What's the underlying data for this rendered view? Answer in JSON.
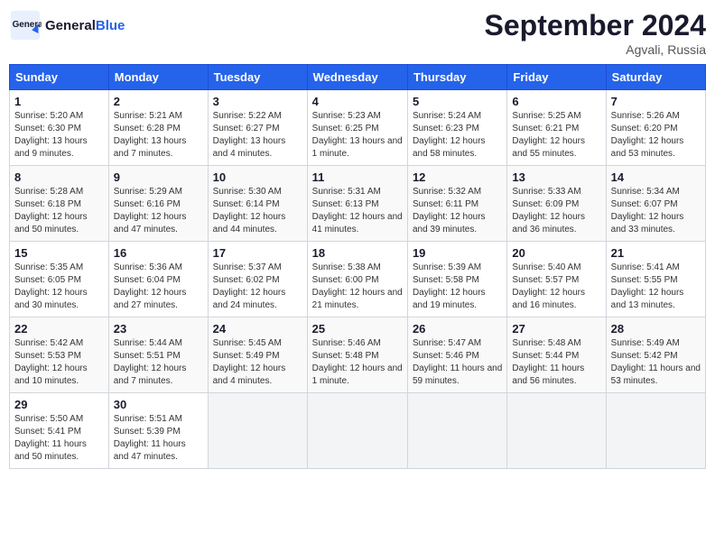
{
  "logo": {
    "text_general": "General",
    "text_blue": "Blue"
  },
  "title": "September 2024",
  "location": "Agvali, Russia",
  "weekdays": [
    "Sunday",
    "Monday",
    "Tuesday",
    "Wednesday",
    "Thursday",
    "Friday",
    "Saturday"
  ],
  "weeks": [
    [
      {
        "day": "1",
        "sunrise": "Sunrise: 5:20 AM",
        "sunset": "Sunset: 6:30 PM",
        "daylight": "Daylight: 13 hours and 9 minutes."
      },
      {
        "day": "2",
        "sunrise": "Sunrise: 5:21 AM",
        "sunset": "Sunset: 6:28 PM",
        "daylight": "Daylight: 13 hours and 7 minutes."
      },
      {
        "day": "3",
        "sunrise": "Sunrise: 5:22 AM",
        "sunset": "Sunset: 6:27 PM",
        "daylight": "Daylight: 13 hours and 4 minutes."
      },
      {
        "day": "4",
        "sunrise": "Sunrise: 5:23 AM",
        "sunset": "Sunset: 6:25 PM",
        "daylight": "Daylight: 13 hours and 1 minute."
      },
      {
        "day": "5",
        "sunrise": "Sunrise: 5:24 AM",
        "sunset": "Sunset: 6:23 PM",
        "daylight": "Daylight: 12 hours and 58 minutes."
      },
      {
        "day": "6",
        "sunrise": "Sunrise: 5:25 AM",
        "sunset": "Sunset: 6:21 PM",
        "daylight": "Daylight: 12 hours and 55 minutes."
      },
      {
        "day": "7",
        "sunrise": "Sunrise: 5:26 AM",
        "sunset": "Sunset: 6:20 PM",
        "daylight": "Daylight: 12 hours and 53 minutes."
      }
    ],
    [
      {
        "day": "8",
        "sunrise": "Sunrise: 5:28 AM",
        "sunset": "Sunset: 6:18 PM",
        "daylight": "Daylight: 12 hours and 50 minutes."
      },
      {
        "day": "9",
        "sunrise": "Sunrise: 5:29 AM",
        "sunset": "Sunset: 6:16 PM",
        "daylight": "Daylight: 12 hours and 47 minutes."
      },
      {
        "day": "10",
        "sunrise": "Sunrise: 5:30 AM",
        "sunset": "Sunset: 6:14 PM",
        "daylight": "Daylight: 12 hours and 44 minutes."
      },
      {
        "day": "11",
        "sunrise": "Sunrise: 5:31 AM",
        "sunset": "Sunset: 6:13 PM",
        "daylight": "Daylight: 12 hours and 41 minutes."
      },
      {
        "day": "12",
        "sunrise": "Sunrise: 5:32 AM",
        "sunset": "Sunset: 6:11 PM",
        "daylight": "Daylight: 12 hours and 39 minutes."
      },
      {
        "day": "13",
        "sunrise": "Sunrise: 5:33 AM",
        "sunset": "Sunset: 6:09 PM",
        "daylight": "Daylight: 12 hours and 36 minutes."
      },
      {
        "day": "14",
        "sunrise": "Sunrise: 5:34 AM",
        "sunset": "Sunset: 6:07 PM",
        "daylight": "Daylight: 12 hours and 33 minutes."
      }
    ],
    [
      {
        "day": "15",
        "sunrise": "Sunrise: 5:35 AM",
        "sunset": "Sunset: 6:05 PM",
        "daylight": "Daylight: 12 hours and 30 minutes."
      },
      {
        "day": "16",
        "sunrise": "Sunrise: 5:36 AM",
        "sunset": "Sunset: 6:04 PM",
        "daylight": "Daylight: 12 hours and 27 minutes."
      },
      {
        "day": "17",
        "sunrise": "Sunrise: 5:37 AM",
        "sunset": "Sunset: 6:02 PM",
        "daylight": "Daylight: 12 hours and 24 minutes."
      },
      {
        "day": "18",
        "sunrise": "Sunrise: 5:38 AM",
        "sunset": "Sunset: 6:00 PM",
        "daylight": "Daylight: 12 hours and 21 minutes."
      },
      {
        "day": "19",
        "sunrise": "Sunrise: 5:39 AM",
        "sunset": "Sunset: 5:58 PM",
        "daylight": "Daylight: 12 hours and 19 minutes."
      },
      {
        "day": "20",
        "sunrise": "Sunrise: 5:40 AM",
        "sunset": "Sunset: 5:57 PM",
        "daylight": "Daylight: 12 hours and 16 minutes."
      },
      {
        "day": "21",
        "sunrise": "Sunrise: 5:41 AM",
        "sunset": "Sunset: 5:55 PM",
        "daylight": "Daylight: 12 hours and 13 minutes."
      }
    ],
    [
      {
        "day": "22",
        "sunrise": "Sunrise: 5:42 AM",
        "sunset": "Sunset: 5:53 PM",
        "daylight": "Daylight: 12 hours and 10 minutes."
      },
      {
        "day": "23",
        "sunrise": "Sunrise: 5:44 AM",
        "sunset": "Sunset: 5:51 PM",
        "daylight": "Daylight: 12 hours and 7 minutes."
      },
      {
        "day": "24",
        "sunrise": "Sunrise: 5:45 AM",
        "sunset": "Sunset: 5:49 PM",
        "daylight": "Daylight: 12 hours and 4 minutes."
      },
      {
        "day": "25",
        "sunrise": "Sunrise: 5:46 AM",
        "sunset": "Sunset: 5:48 PM",
        "daylight": "Daylight: 12 hours and 1 minute."
      },
      {
        "day": "26",
        "sunrise": "Sunrise: 5:47 AM",
        "sunset": "Sunset: 5:46 PM",
        "daylight": "Daylight: 11 hours and 59 minutes."
      },
      {
        "day": "27",
        "sunrise": "Sunrise: 5:48 AM",
        "sunset": "Sunset: 5:44 PM",
        "daylight": "Daylight: 11 hours and 56 minutes."
      },
      {
        "day": "28",
        "sunrise": "Sunrise: 5:49 AM",
        "sunset": "Sunset: 5:42 PM",
        "daylight": "Daylight: 11 hours and 53 minutes."
      }
    ],
    [
      {
        "day": "29",
        "sunrise": "Sunrise: 5:50 AM",
        "sunset": "Sunset: 5:41 PM",
        "daylight": "Daylight: 11 hours and 50 minutes."
      },
      {
        "day": "30",
        "sunrise": "Sunrise: 5:51 AM",
        "sunset": "Sunset: 5:39 PM",
        "daylight": "Daylight: 11 hours and 47 minutes."
      },
      null,
      null,
      null,
      null,
      null
    ]
  ]
}
